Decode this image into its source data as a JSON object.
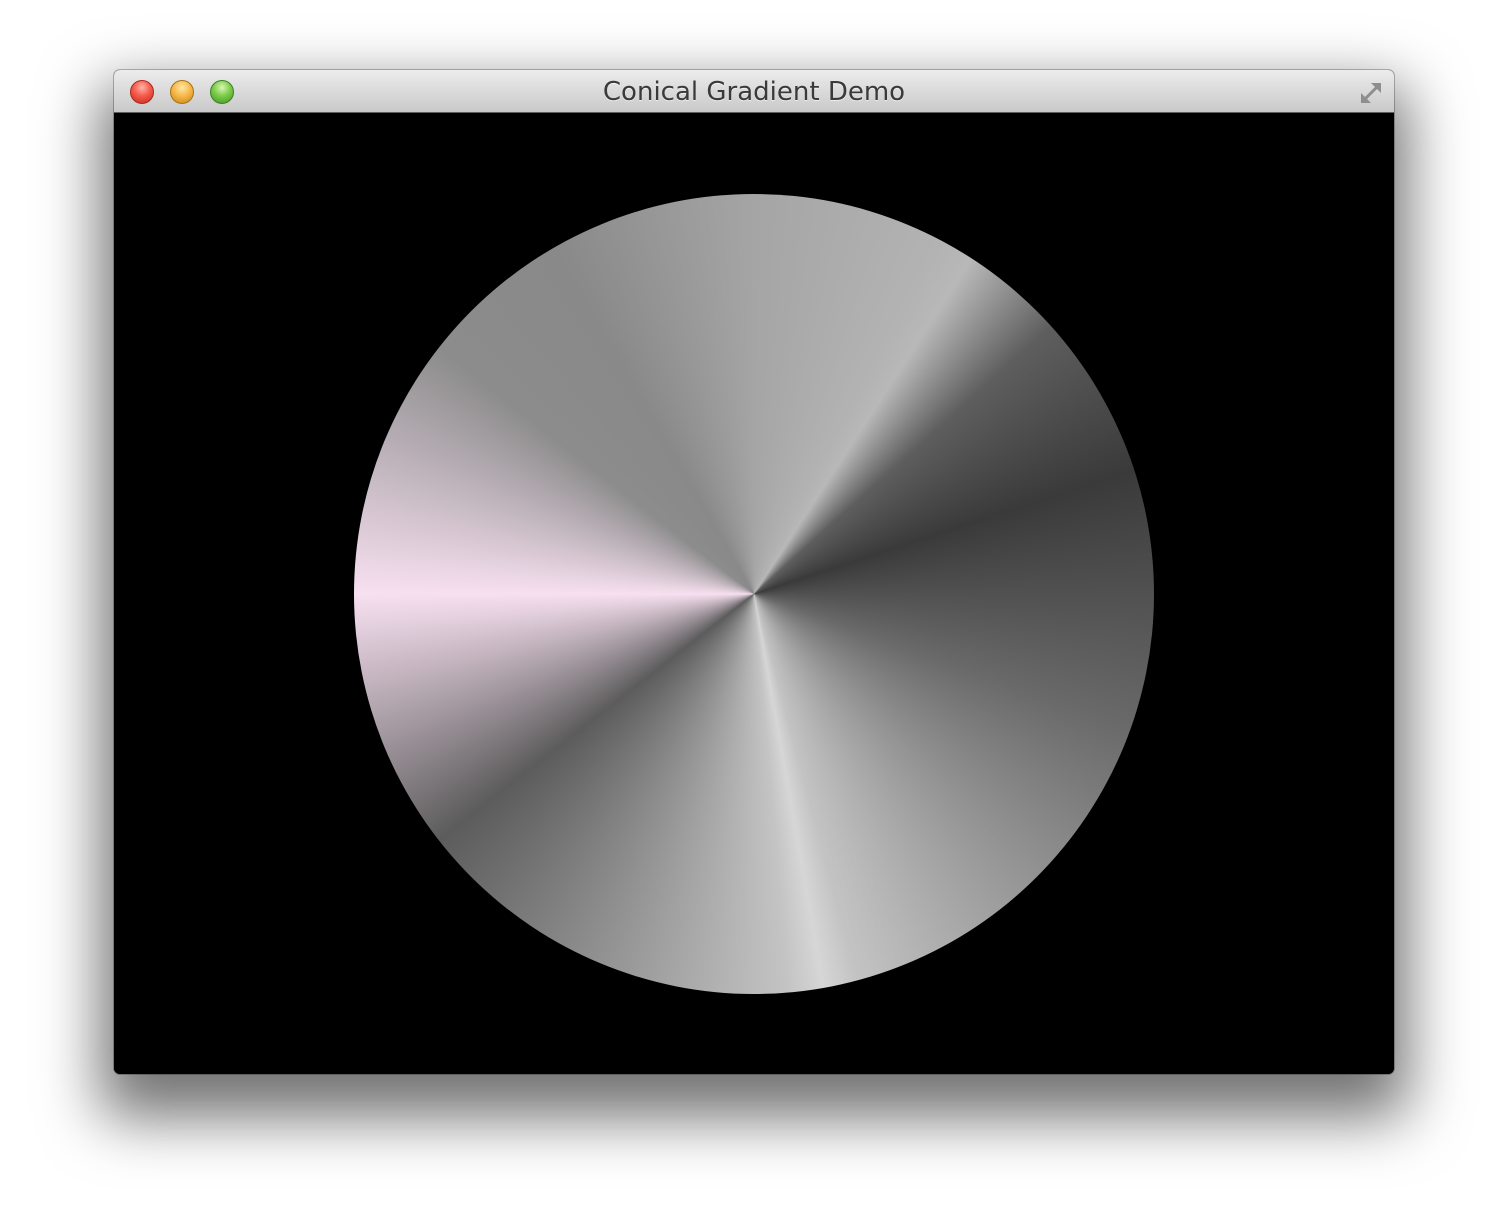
{
  "window": {
    "title": "Conical Gradient Demo"
  },
  "titlebar": {
    "close_icon": "close-icon",
    "minimize_icon": "minimize-icon",
    "zoom_icon": "zoom-icon",
    "fullscreen_icon": "fullscreen-icon"
  },
  "canvas": {
    "background": "#000000",
    "gradient_stops": [
      {
        "angle_deg": 0,
        "color": "#a5a5a5"
      },
      {
        "angle_deg": 28,
        "color": "#b3b3b3"
      },
      {
        "angle_deg": 33,
        "color": "#b8b8b8"
      },
      {
        "angle_deg": 48,
        "color": "#5e5e5e"
      },
      {
        "angle_deg": 72,
        "color": "#3a3a3a"
      },
      {
        "angle_deg": 110,
        "color": "#6a6a6a"
      },
      {
        "angle_deg": 165,
        "color": "#c3c3c3"
      },
      {
        "angle_deg": 170,
        "color": "#d6d6d6"
      },
      {
        "angle_deg": 175,
        "color": "#c4c4c4"
      },
      {
        "angle_deg": 232,
        "color": "#5c5c5c"
      },
      {
        "angle_deg": 270,
        "color": "#f7e0f0"
      },
      {
        "angle_deg": 308,
        "color": "#8c8c8c"
      },
      {
        "angle_deg": 330,
        "color": "#898989"
      },
      {
        "angle_deg": 360,
        "color": "#a5a5a5"
      }
    ]
  }
}
